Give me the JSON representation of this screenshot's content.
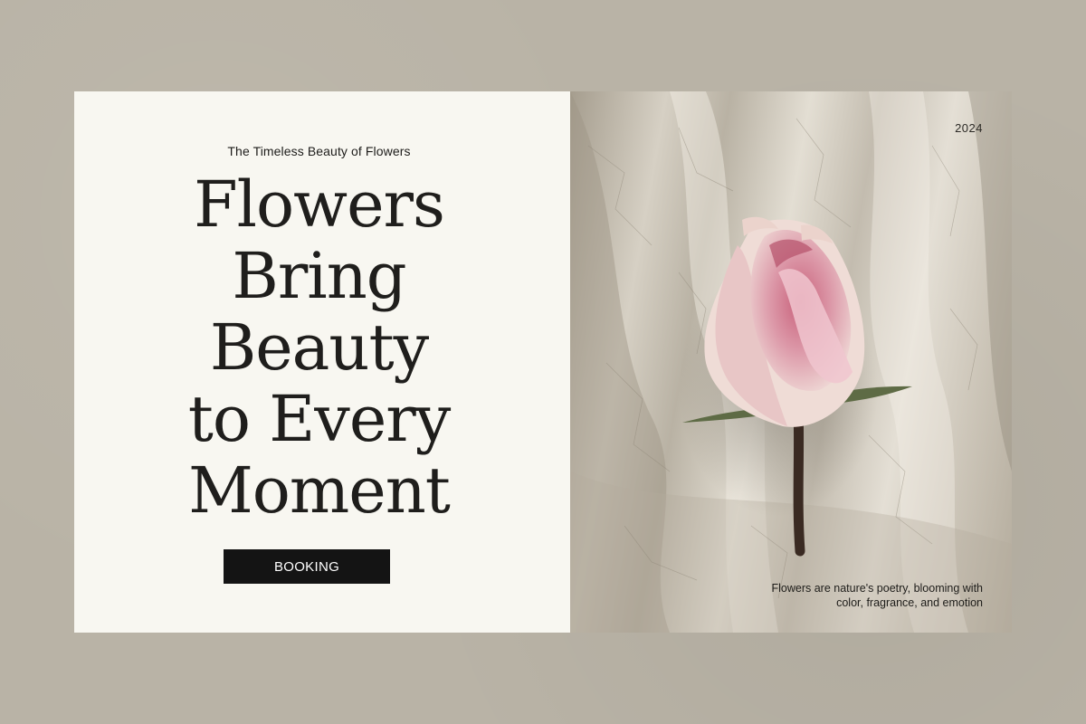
{
  "hero": {
    "tagline": "The Timeless Beauty of Flowers",
    "headline_lines": [
      "Flowers",
      "Bring",
      "Beauty",
      "to Every",
      "Moment"
    ],
    "cta_label": "BOOKING"
  },
  "image_panel": {
    "year": "2024",
    "caption_line1": "Flowers are nature's poetry, blooming with",
    "caption_line2": "color, fragrance, and emotion",
    "photo": "rose-bud-on-silk-fabric"
  },
  "colors": {
    "page_background": "#b9b3a6",
    "panel_background": "#f8f7f1",
    "button_background": "#141414",
    "text": "#1f1e1c",
    "rose_pink": "#d88a9c"
  }
}
